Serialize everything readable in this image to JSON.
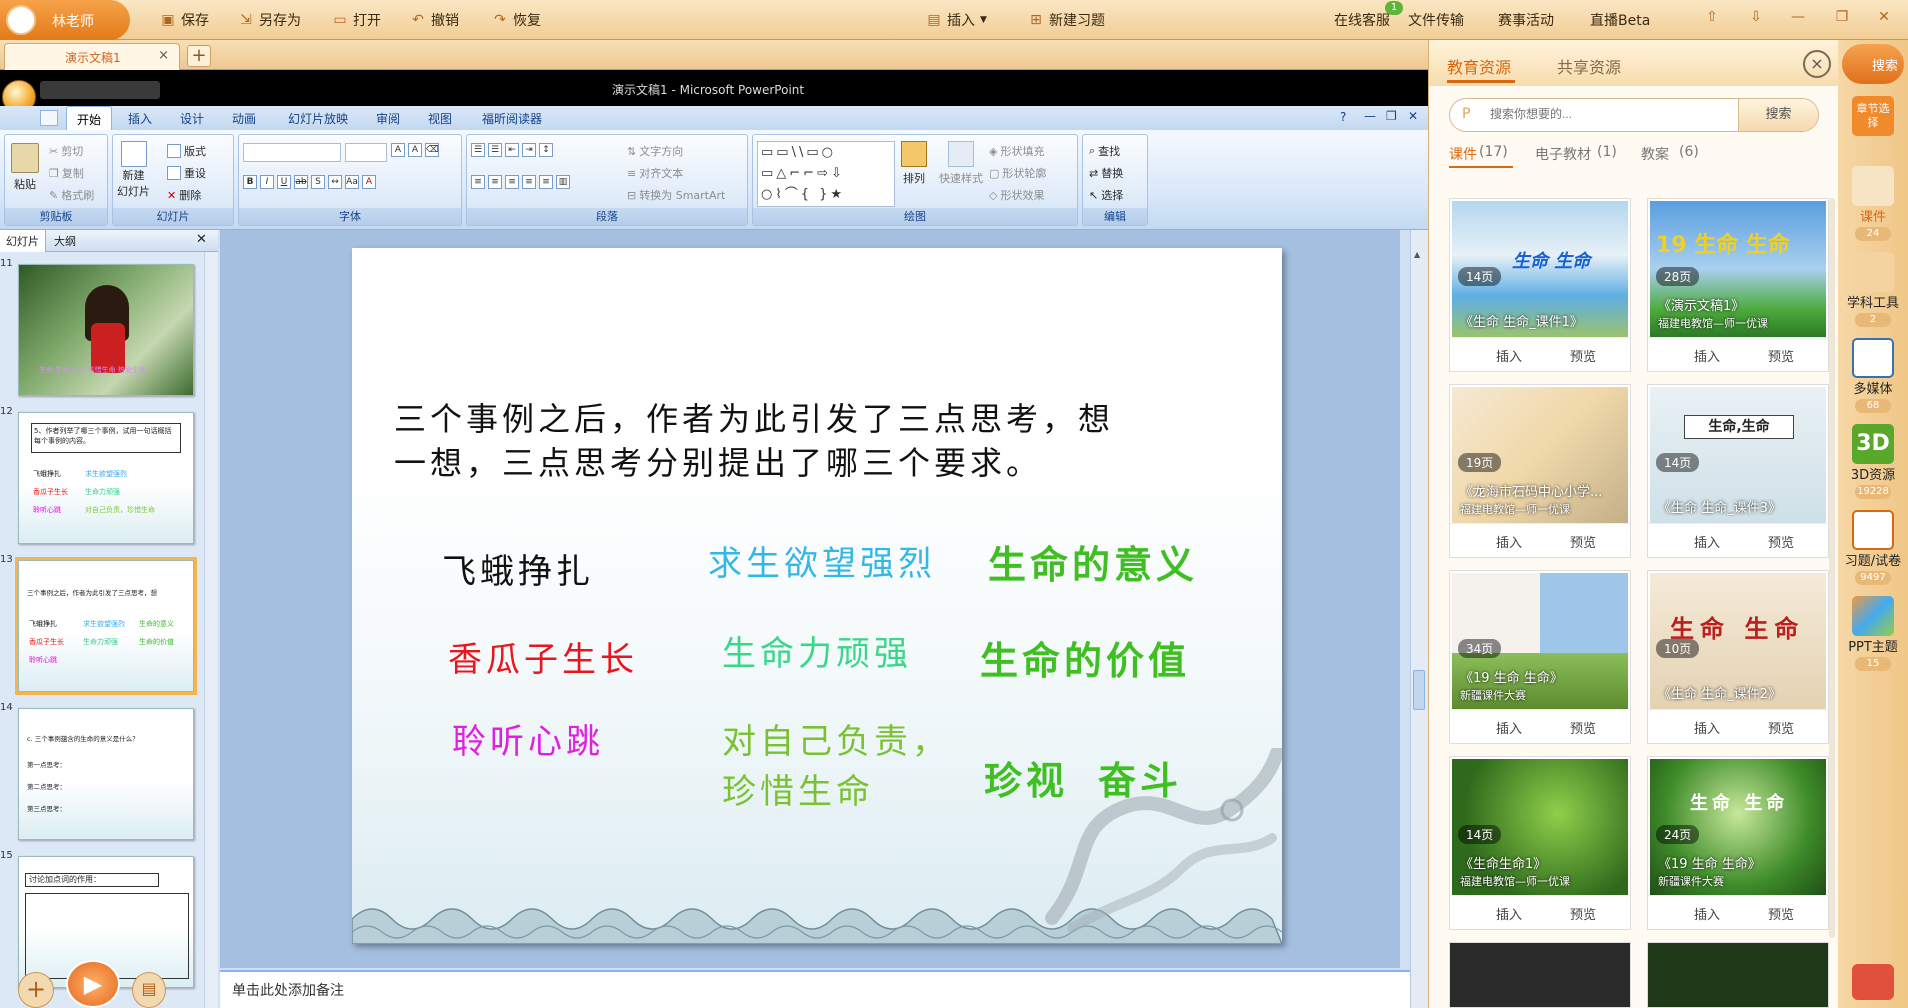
{
  "topbar": {
    "user": "林老师",
    "save": "保存",
    "saveas": "另存为",
    "open": "打开",
    "undo": "撤销",
    "redo": "恢复",
    "insert": "插入",
    "newq": "新建习题",
    "online": "在线客服",
    "badge": "1",
    "transfer": "文件传输",
    "events": "赛事活动",
    "live": "直播Beta"
  },
  "doc_tab": {
    "name": "演示文稿1",
    "close": "×",
    "plus": "+"
  },
  "ppt": {
    "title": "演示文稿1 - Microsoft PowerPoint",
    "tabs": [
      "开始",
      "插入",
      "设计",
      "动画",
      "幻灯片放映",
      "审阅",
      "视图",
      "福昕阅读器"
    ],
    "groups": {
      "clipboard": "剪贴板",
      "slides": "幻灯片",
      "font": "字体",
      "paragraph": "段落",
      "drawing": "绘图",
      "editing": "编辑"
    },
    "buttons": {
      "paste": "粘贴",
      "cut": "剪切",
      "copy": "复制",
      "format": "格式刷",
      "newslide": "新建",
      "newslide2": "幻灯片",
      "layout": "版式",
      "reset": "重设",
      "delete": "删除",
      "textdir": "文字方向",
      "align": "对齐文本",
      "smartart": "转换为 SmartArt",
      "arrange": "排列",
      "quick": "快速样式",
      "fill": "形状填充",
      "outline": "形状轮廓",
      "effects": "形状效果",
      "find": "查找",
      "replace": "替换",
      "select": "选择"
    },
    "pane_tabs": [
      "幻灯片",
      "大纲"
    ],
    "slide_numbers": [
      "11",
      "12",
      "13",
      "14",
      "15"
    ],
    "notes": "单击此处添加备注"
  },
  "slide": {
    "question_l1": "三个事例之后，作者为此引发了三点思考，想",
    "question_l2": "一想，三点思考分别提出了哪三个要求。",
    "rows": [
      {
        "a": "飞蛾挣扎",
        "b": "求生欲望强烈",
        "c": "生命的意义"
      },
      {
        "a": "香瓜子生长",
        "b": "生命力顽强",
        "c": "生命的价值"
      },
      {
        "a": "聆听心跳",
        "b1": "对自己负责，",
        "b2": "珍惜生命",
        "c1": "珍视",
        "c2": "奋斗"
      }
    ],
    "colors": {
      "q": "#111111",
      "r1a": "#111111",
      "r1b": "#33b8e6",
      "r1c": "#3fbf22",
      "r2a": "#e8161e",
      "r2b": "#3ad68a",
      "r2c": "#3fbf22",
      "r3a": "#e020e0",
      "r3b": "#7ac232",
      "r3c": "#3fbf22"
    }
  },
  "thumbs": {
    "t11": "生命 生命 —— 珍惜生命 热爱生命",
    "t12_title": "5、作者列举了哪三个事例，试用一句话概括每个事例的内容。",
    "t12_items": [
      "飞蛾挣扎",
      "香瓜子生长",
      "聆听心跳"
    ],
    "t12_right": [
      "求生欲望强烈",
      "生命力顽强",
      "对自己负责，珍惜生命"
    ],
    "t14_lines": [
      "c. 三个事例蕴含的生命的意义是什么？",
      "第一点思考：",
      "第二点思考：",
      "第三点思考："
    ],
    "t15_title": "讨论加点词的作用："
  },
  "resources": {
    "tabs": [
      "教育资源",
      "共享资源"
    ],
    "close": "×",
    "search_placeholder": "搜索你想要的...",
    "search_btn": "搜索",
    "cats": [
      "课件",
      "(17)",
      "电子教材",
      "(1)",
      "教案",
      "(6)"
    ],
    "cards": [
      {
        "pages": "14页",
        "title": "《生命 生命_课件1》",
        "src": "",
        "art": "生命 生命",
        "insert": "插入",
        "preview": "预览"
      },
      {
        "pages": "28页",
        "title": "《演示文稿1》",
        "src": "福建电教馆—师一优课",
        "art": "19 生命 生命",
        "insert": "插入",
        "preview": "预览"
      },
      {
        "pages": "19页",
        "title": "《龙海市石码中心小学...",
        "src": "福建电教馆—师一优课",
        "art": "",
        "insert": "插入",
        "preview": "预览"
      },
      {
        "pages": "14页",
        "title": "《生命 生命_课件3》",
        "src": "",
        "art": "生命,生命",
        "insert": "插入",
        "preview": "预览"
      },
      {
        "pages": "34页",
        "title": "《19 生命 生命》",
        "src": "新疆课件大赛",
        "art": "",
        "insert": "插入",
        "preview": "预览"
      },
      {
        "pages": "10页",
        "title": "《生命 生命_课件2》",
        "src": "",
        "art": "生命 生命",
        "insert": "插入",
        "preview": "预览"
      },
      {
        "pages": "14页",
        "title": "《生命生命1》",
        "src": "福建电教馆—师一优课",
        "art": "",
        "insert": "插入",
        "preview": "预览"
      },
      {
        "pages": "24页",
        "title": "《19 生命 生命》",
        "src": "新疆课件大赛",
        "art": "生命 生命",
        "insert": "插入",
        "preview": "预览"
      }
    ]
  },
  "sidebar": {
    "search": "搜索",
    "chapter": "章节选择",
    "items": [
      {
        "label": "课件",
        "count": "24"
      },
      {
        "label": "学科工具",
        "count": "2"
      },
      {
        "label": "多媒体",
        "count": "68"
      },
      {
        "label": "3D资源",
        "count": "19228"
      },
      {
        "label": "习题/试卷",
        "count": "9497"
      },
      {
        "label": "PPT主题",
        "count": "15"
      }
    ]
  }
}
